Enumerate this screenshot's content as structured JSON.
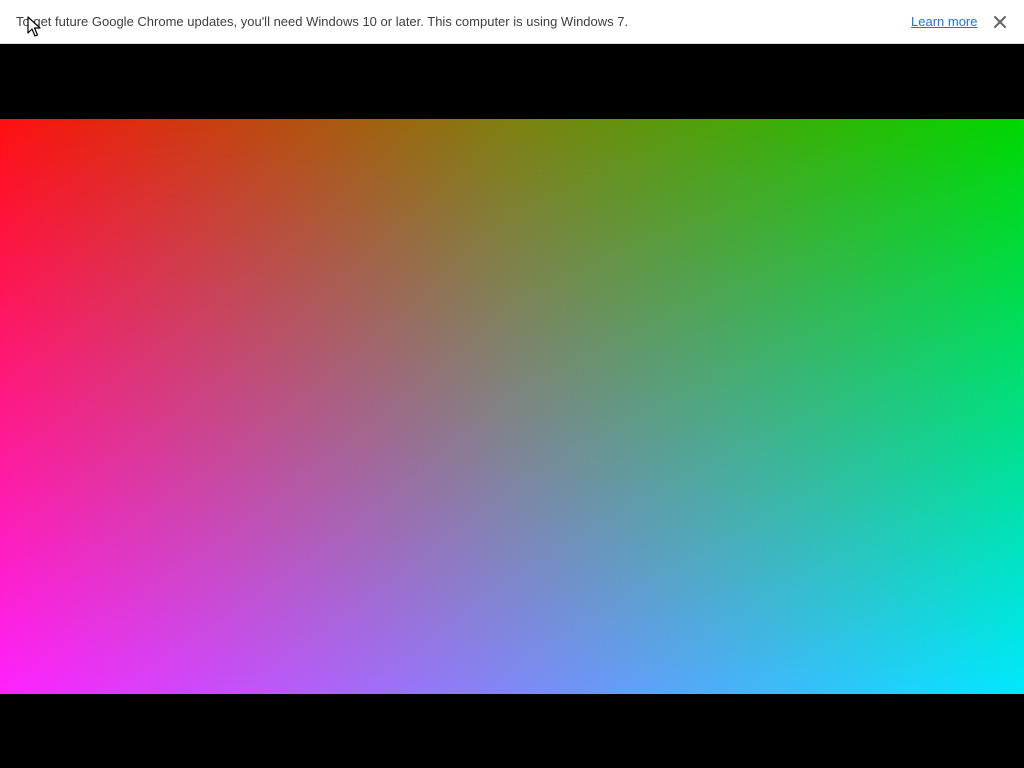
{
  "infobar": {
    "message": "To get future Google Chrome updates, you'll need Windows 10 or later. This computer is using Windows 7.",
    "learn_more_label": "Learn more",
    "close_icon": "close-icon"
  },
  "video": {
    "gradient_colors": {
      "top_left": "#ff1010",
      "top_center": "#7f8010",
      "top_right": "#00d800",
      "bottom_left": "#ff22ff",
      "bottom_center": "#7f88f8",
      "bottom_right": "#00e8ff"
    }
  },
  "colors": {
    "infobar_background": "#ffffff",
    "infobar_text": "#3c4043",
    "link": "#1a73e8",
    "page_background": "#000000"
  }
}
